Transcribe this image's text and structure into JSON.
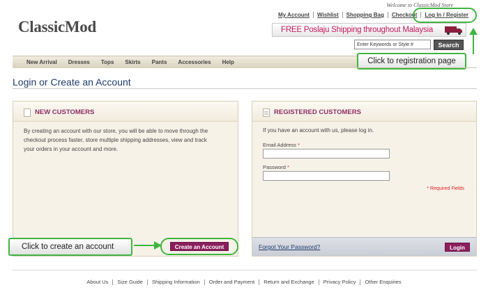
{
  "header": {
    "welcome": "Welcome to ClassicMod Store",
    "logo": "ClassicMod",
    "top_links": [
      "My Account",
      "Wishlist",
      "Shopping Bag",
      "Checkout",
      "Log In / Register"
    ],
    "shipping_banner": "FREE Poslaju Shipping throughout Malaysia",
    "search": {
      "placeholder": "Enter Keywords or Style #",
      "button": "Search"
    }
  },
  "nav": {
    "items": [
      "New Arrival",
      "Dresses",
      "Tops",
      "Skirts",
      "Pants",
      "Accessories",
      "Help"
    ]
  },
  "page": {
    "title": "Login or Create an Account"
  },
  "new_customers": {
    "heading": "NEW CUSTOMERS",
    "line1": "By creating an account with our store, you will be able to move through the",
    "line2": "checkout process faster, store multiple shipping addresses, view and track",
    "line3": "your orders in your account and more.",
    "button": "Create an Account"
  },
  "registered_customers": {
    "heading": "REGISTERED CUSTOMERS",
    "intro": "If you have an account with us, please log in.",
    "email_label": "Email Address",
    "password_label": "Password",
    "required_mark": "*",
    "required_note": "* Required Fields",
    "forgot": "Forgot Your Password?",
    "button": "Login"
  },
  "callouts": {
    "registration": "Click to registration page",
    "create": "Click to create an account",
    "color": "#3fb53f"
  },
  "footer": {
    "links": [
      "About Us",
      "Size Guide",
      "Shipping Information",
      "Order and Payment",
      "Return and Exchange",
      "Privacy Policy",
      "Other Enquiries"
    ]
  },
  "colors": {
    "accent": "#8b1f5d",
    "title": "#1f3b6b",
    "banner_text": "#c2185b",
    "panel_bg": "#f6f2e8"
  },
  "icons": {
    "truck": "delivery-truck-icon",
    "document": "document-icon"
  }
}
